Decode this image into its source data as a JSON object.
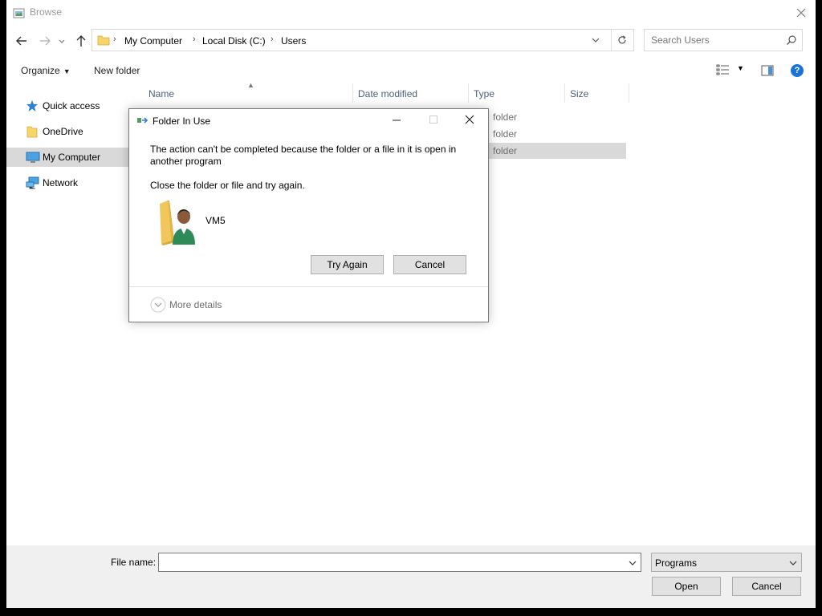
{
  "window": {
    "title": "Browse"
  },
  "address": {
    "crumbs": [
      "My Computer",
      "Local Disk (C:)",
      "Users"
    ]
  },
  "search": {
    "placeholder": "Search Users"
  },
  "toolbar": {
    "organize": "Organize",
    "new_folder": "New folder",
    "help": "?"
  },
  "sidebar": {
    "items": [
      {
        "label": "Quick access",
        "icon": "star-icon"
      },
      {
        "label": "OneDrive",
        "icon": "folder-icon"
      },
      {
        "label": "My Computer",
        "icon": "computer-icon",
        "selected": true
      },
      {
        "label": "Network",
        "icon": "network-icon"
      }
    ]
  },
  "columns": {
    "name": "Name",
    "date": "Date modified",
    "type": "Type",
    "size": "Size"
  },
  "rows": [
    {
      "type": "folder"
    },
    {
      "type": "folder"
    },
    {
      "type": "folder",
      "selected": true
    }
  ],
  "bottom": {
    "file_name_label": "File name:",
    "file_name_value": "",
    "filter": "Programs",
    "open": "Open",
    "cancel": "Cancel"
  },
  "dialog": {
    "title": "Folder In Use",
    "message": "The action can't be completed because the folder or a file in it is open in another program",
    "message2": "Close the folder or file and try again.",
    "item_name": "VM5",
    "try_again": "Try Again",
    "cancel": "Cancel",
    "more_details": "More details"
  },
  "colors": {
    "accent": "#1a73d9",
    "selection": "#d9d9d9",
    "header_text": "#4c607a",
    "folder": "#f6d56b"
  }
}
